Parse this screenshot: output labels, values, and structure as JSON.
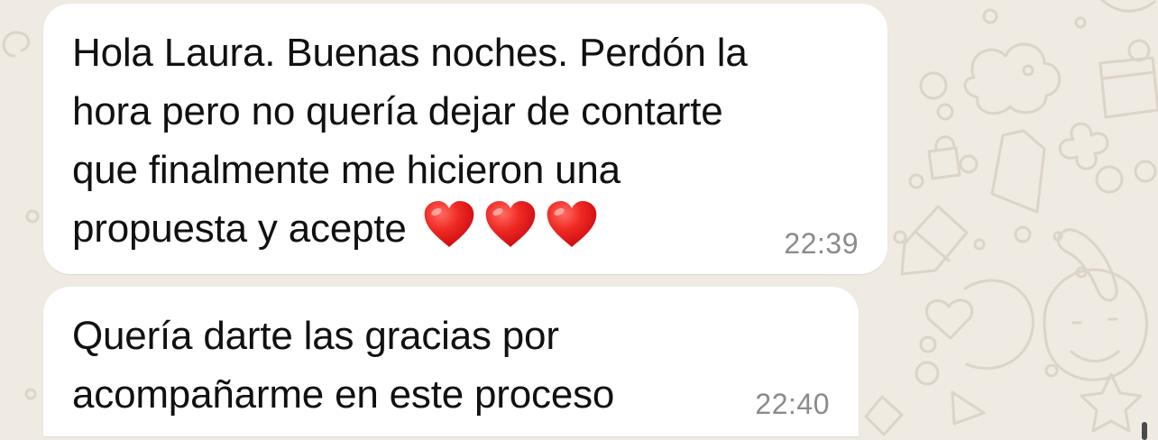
{
  "colors": {
    "wallpaper": "#efeae2",
    "wallpaper_doodle": "#d9d0c3",
    "bubble": "#ffffff",
    "text": "#111111",
    "timestamp": "#8b8b8b",
    "heart": "#e8151b"
  },
  "messages": [
    {
      "lines": [
        "Hola Laura. Buenas noches. Perdón la",
        "hora pero no quería dejar de contarte",
        "que finalmente me hicieron una",
        "propuesta y acepte"
      ],
      "emoji": [
        "red-heart",
        "red-heart",
        "red-heart"
      ],
      "time": "22:39"
    },
    {
      "lines": [
        "Quería darte las gracias por",
        "acompañarme en este proceso"
      ],
      "time": "22:40"
    }
  ]
}
